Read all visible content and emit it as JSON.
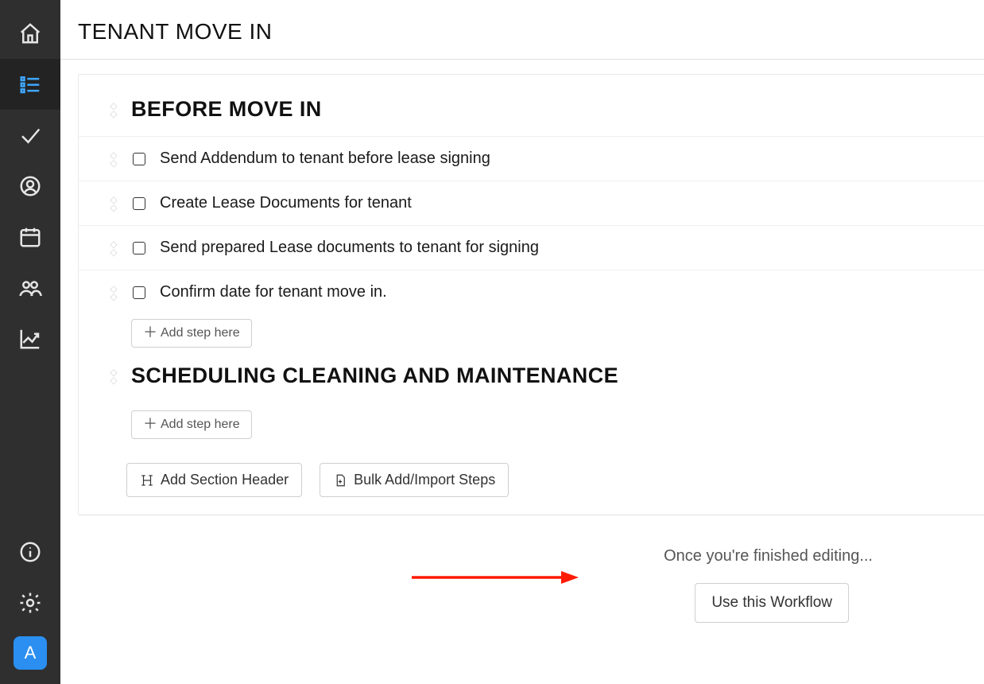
{
  "sidebar": {
    "avatar_letter": "A"
  },
  "page": {
    "title": "TENANT MOVE IN"
  },
  "sections": [
    {
      "header": "BEFORE MOVE IN",
      "steps": [
        "Send Addendum to tenant before lease signing",
        "Create Lease Documents for tenant",
        "Send prepared Lease documents to tenant for signing",
        "Confirm date for tenant move in."
      ],
      "add_step_label": "Add step here"
    },
    {
      "header": "SCHEDULING CLEANING AND MAINTENANCE",
      "steps": [],
      "add_step_label": "Add step here"
    }
  ],
  "card_footer": {
    "add_section_header": "Add Section Header",
    "bulk_add": "Bulk Add/Import Steps"
  },
  "bottom": {
    "finished_text": "Once you're finished editing...",
    "use_workflow": "Use this Workflow"
  }
}
